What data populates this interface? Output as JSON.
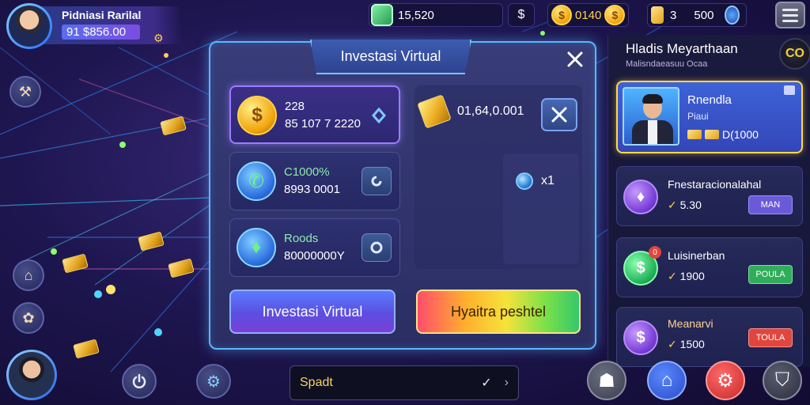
{
  "player": {
    "name": "Pidniasi Rarilal",
    "money": "91 $856.00"
  },
  "topbar": {
    "gems": "15,520",
    "coins": "0140",
    "tokens": "3",
    "cash": "500"
  },
  "modal": {
    "title": "Investasi Virtual",
    "cards": [
      {
        "line1": "228",
        "line2": "85 107 7 2220"
      },
      {
        "line1": "C1000%",
        "line2": "8993 0001"
      },
      {
        "line1": "Roods",
        "line2": "80000000Y"
      }
    ],
    "gold_value": "01,64,0.001",
    "multiplier": "x1",
    "primary_button": "Investasi Virtual",
    "secondary_button": "Hyaitra peshtel"
  },
  "sidebar": {
    "title": "Hladis Meyarthaan",
    "subtitle": "Malisndaeasuu Ocaa",
    "corner_label": "CO",
    "items": [
      {
        "title": "Rnendla",
        "subtitle": "Piaui",
        "value": "D(1000"
      },
      {
        "title": "Fnestaracionalahal",
        "value": "5.30",
        "tag": "MAN"
      },
      {
        "title": "Luisinerban",
        "value": "1900",
        "tag": "POULA"
      },
      {
        "title": "Meanarvi",
        "value": "1500",
        "tag": "TOULA"
      }
    ],
    "badge": "0"
  },
  "search": {
    "value": "Spadt"
  },
  "colors": {
    "accent_cyan": "#59b8ff",
    "accent_purple": "#9b7cff",
    "gold": "#ffd24a",
    "tag_purple": "#6b5ad8",
    "tag_green": "#2fae5a",
    "tag_red": "#e0463e"
  },
  "icons": {
    "close": "close-icon",
    "gear": "gear-icon",
    "home": "home-icon",
    "power": "power-icon",
    "menu": "menu-icon"
  }
}
